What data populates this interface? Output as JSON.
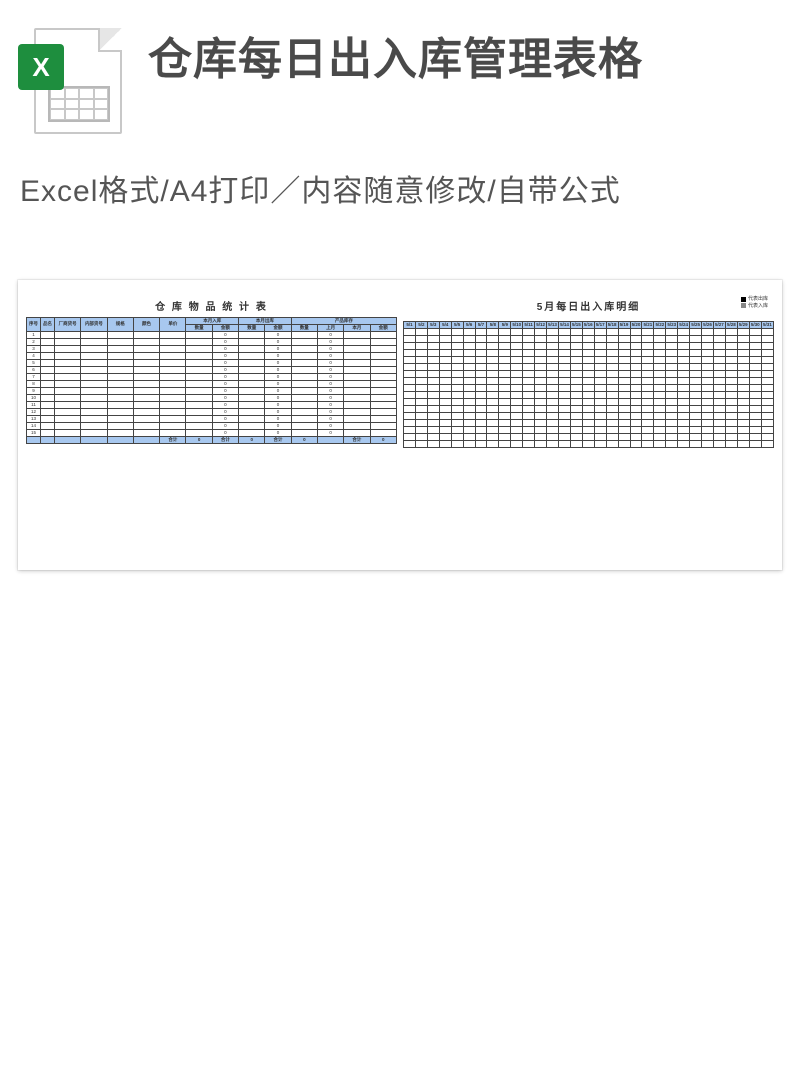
{
  "header": {
    "title": "仓库每日出入库管理表格",
    "icon_letter": "X"
  },
  "subtitle": "Excel格式/A4打印／内容随意修改/自带公式",
  "preview": {
    "left": {
      "title": "仓 库 物 品 统 计 表",
      "columns_top": [
        "序号",
        "品名",
        "厂商货号",
        "内部货号",
        "规格",
        "颜色",
        "单价",
        "本月入库",
        "本月出库",
        "产品库存"
      ],
      "columns_sub": [
        "",
        "",
        "",
        "",
        "",
        "",
        "",
        "数量",
        "金额",
        "数量",
        "金额",
        "数量",
        "上月",
        "本月",
        "金额"
      ],
      "totals_row": [
        "",
        "",
        "",
        "",
        "",
        "",
        "合计",
        "0",
        "合计",
        "0",
        "合计",
        "0",
        "",
        "合计",
        "0"
      ],
      "row_count": 15
    },
    "right": {
      "title": "5月每日出入库明细",
      "legend": {
        "out": "代表出库",
        "in": "代表入库"
      },
      "dates": [
        "5/1",
        "5/2",
        "5/3",
        "5/4",
        "5/5",
        "5/6",
        "5/7",
        "5/8",
        "5/9",
        "5/10",
        "5/11",
        "5/12",
        "5/13",
        "5/14",
        "5/15",
        "5/16",
        "5/17",
        "5/18",
        "5/19",
        "5/20",
        "5/21",
        "5/22",
        "5/23",
        "5/24",
        "5/25",
        "5/26",
        "5/27",
        "5/28",
        "5/29",
        "5/30",
        "5/31"
      ],
      "row_count": 17
    }
  }
}
